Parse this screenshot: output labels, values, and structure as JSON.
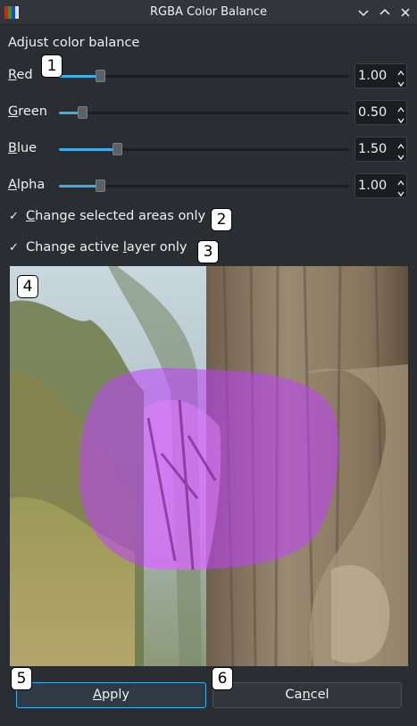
{
  "window": {
    "title": "RGBA Color Balance",
    "controls": [
      "minimize-icon",
      "maximize-icon",
      "close-icon"
    ]
  },
  "heading": "Adjust color balance",
  "sliders": [
    {
      "label_mnemonic": "R",
      "label_rest": "ed",
      "value": "1.00",
      "fraction": 0.14
    },
    {
      "label_mnemonic": "G",
      "label_rest": "reen",
      "value": "0.50",
      "fraction": 0.08
    },
    {
      "label_mnemonic": "B",
      "label_rest": "lue",
      "value": "1.50",
      "fraction": 0.2
    },
    {
      "label_mnemonic": "A",
      "label_rest": "lpha",
      "value": "1.00",
      "fraction": 0.14
    }
  ],
  "checkboxes": [
    {
      "before": "",
      "mnemonic": "C",
      "after": "hange selected areas only",
      "checked": true,
      "check_glyph": "✓"
    },
    {
      "before": "Change active ",
      "mnemonic": "l",
      "after": "ayer only",
      "checked": true,
      "check_glyph": "✓"
    }
  ],
  "markers": [
    "1",
    "2",
    "3",
    "4",
    "5",
    "6"
  ],
  "buttons": {
    "apply": {
      "mnemonic": "A",
      "rest": "pply"
    },
    "cancel": {
      "before": "Ca",
      "mnemonic": "n",
      "after": "cel"
    }
  },
  "colors": {
    "accent": "#3daee9",
    "selection_overlay": "#c040ff",
    "background": "#2a2e32"
  }
}
